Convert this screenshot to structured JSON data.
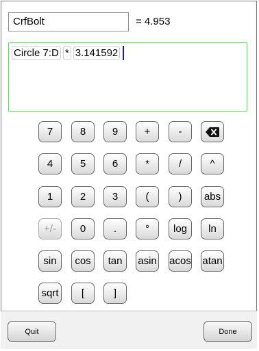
{
  "header": {
    "name_value": "CrfBolt",
    "result_text": "= 4.953"
  },
  "expression": {
    "tokens": [
      "Circle 7:D",
      "*",
      "3.141592"
    ]
  },
  "keypad": {
    "rows": [
      [
        {
          "label": "7",
          "name": "key-7",
          "enabled": true
        },
        {
          "label": "8",
          "name": "key-8",
          "enabled": true
        },
        {
          "label": "9",
          "name": "key-9",
          "enabled": true
        },
        {
          "label": "+",
          "name": "key-plus",
          "enabled": true
        },
        {
          "label": "-",
          "name": "key-minus",
          "enabled": true
        },
        {
          "label": "",
          "icon": "backspace-icon",
          "name": "key-backspace",
          "enabled": true
        }
      ],
      [
        {
          "label": "4",
          "name": "key-4",
          "enabled": true
        },
        {
          "label": "5",
          "name": "key-5",
          "enabled": true
        },
        {
          "label": "6",
          "name": "key-6",
          "enabled": true
        },
        {
          "label": "*",
          "name": "key-multiply",
          "enabled": true
        },
        {
          "label": "/",
          "name": "key-divide",
          "enabled": true
        },
        {
          "label": "^",
          "name": "key-power",
          "enabled": true
        }
      ],
      [
        {
          "label": "1",
          "name": "key-1",
          "enabled": true
        },
        {
          "label": "2",
          "name": "key-2",
          "enabled": true
        },
        {
          "label": "3",
          "name": "key-3",
          "enabled": true
        },
        {
          "label": "(",
          "name": "key-open-paren",
          "enabled": true
        },
        {
          "label": ")",
          "name": "key-close-paren",
          "enabled": true
        },
        {
          "label": "abs",
          "name": "key-abs",
          "enabled": true
        }
      ],
      [
        {
          "label": "+/-",
          "name": "key-negate",
          "enabled": false
        },
        {
          "label": "0",
          "name": "key-0",
          "enabled": true
        },
        {
          "label": ".",
          "name": "key-decimal",
          "enabled": true
        },
        {
          "label": "°",
          "name": "key-degree",
          "enabled": true
        },
        {
          "label": "log",
          "name": "key-log",
          "enabled": true
        },
        {
          "label": "ln",
          "name": "key-ln",
          "enabled": true
        }
      ],
      [
        {
          "label": "sin",
          "name": "key-sin",
          "enabled": true
        },
        {
          "label": "cos",
          "name": "key-cos",
          "enabled": true
        },
        {
          "label": "tan",
          "name": "key-tan",
          "enabled": true
        },
        {
          "label": "asin",
          "name": "key-asin",
          "enabled": true
        },
        {
          "label": "acos",
          "name": "key-acos",
          "enabled": true
        },
        {
          "label": "atan",
          "name": "key-atan",
          "enabled": true
        }
      ],
      [
        {
          "label": "sqrt",
          "name": "key-sqrt",
          "enabled": true
        },
        {
          "label": "[",
          "name": "key-open-bracket",
          "enabled": true
        },
        {
          "label": "]",
          "name": "key-close-bracket",
          "enabled": true
        }
      ]
    ]
  },
  "footer": {
    "quit_label": "Quit",
    "done_label": "Done"
  }
}
